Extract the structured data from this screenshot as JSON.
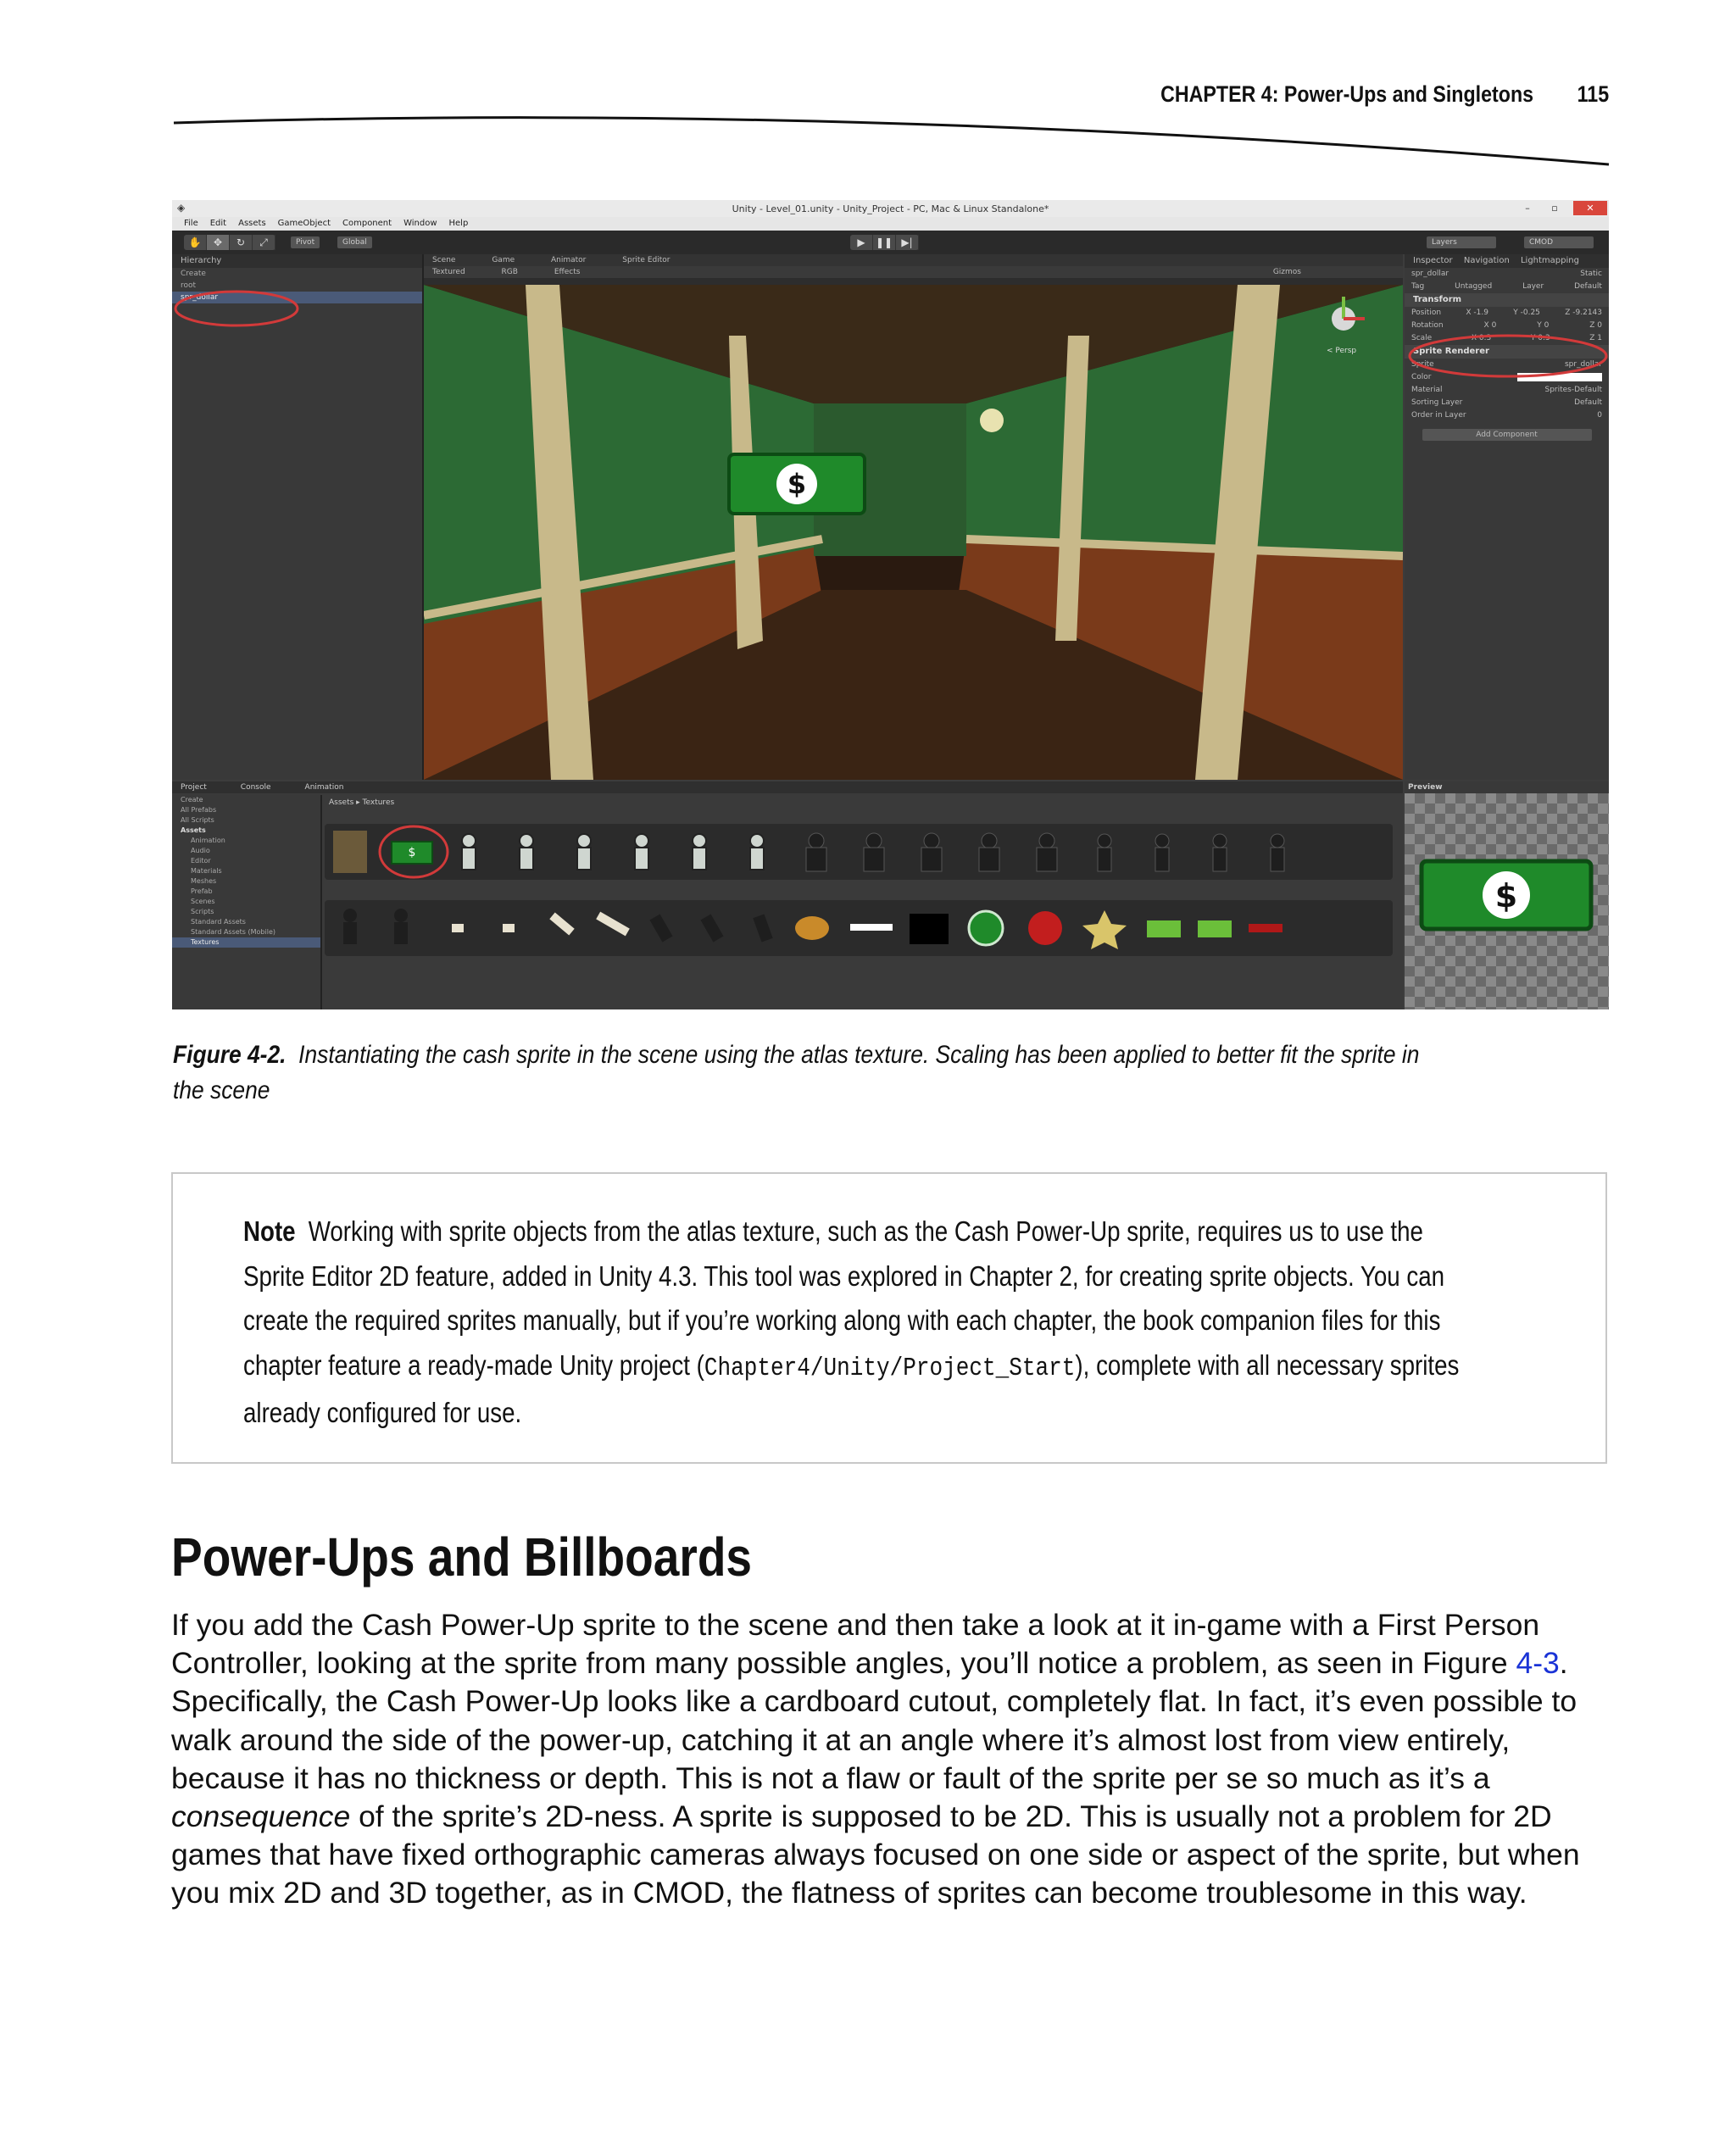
{
  "header": {
    "chapter": "CHAPTER 4: Power-Ups and Singletons",
    "page_number": "115"
  },
  "figure": {
    "unity": {
      "window_title": "Unity - Level_01.unity - Unity_Project - PC, Mac & Linux Standalone*",
      "window_buttons": [
        "–",
        "▫",
        "✕"
      ],
      "menu": [
        "File",
        "Edit",
        "Assets",
        "GameObject",
        "Component",
        "Window",
        "Help"
      ],
      "toolbar": {
        "pivot": "Pivot",
        "global": "Global",
        "layers": "Layers",
        "layout": "CMOD"
      },
      "hierarchy": {
        "tab": "Hierarchy",
        "create": "Create",
        "items": [
          "root",
          "spr_dollar"
        ]
      },
      "scene": {
        "tabs": [
          "Scene",
          "Game",
          "Animator",
          "Sprite Editor"
        ],
        "shading": "Textured",
        "mode": "RGB",
        "effects": "Effects",
        "gizmos": "Gizmos",
        "persp": "< Persp"
      },
      "inspector": {
        "tabs": [
          "Inspector",
          "Navigation",
          "Lightmapping"
        ],
        "object_name": "spr_dollar",
        "static": "Static",
        "tag": "Untagged",
        "layer": "Default",
        "transform": "Transform",
        "position": [
          "X -1.9",
          "Y -0.25",
          "Z -9.2143"
        ],
        "rotation": [
          "X 0",
          "Y 0",
          "Z 0"
        ],
        "scale": [
          "X 0.3",
          "Y 0.3",
          "Z 1"
        ],
        "sprite_renderer": "Sprite Renderer",
        "sprite": "spr_dollar",
        "material": "Sprites-Default",
        "sorting_layer": "Default",
        "order_in_layer": "0",
        "add_component": "Add Component",
        "labels": [
          "Position",
          "Rotation",
          "Scale",
          "Sprite",
          "Color",
          "Material",
          "Sorting Layer",
          "Order in Layer",
          "Tag",
          "Layer"
        ]
      },
      "project": {
        "tabs": [
          "Project",
          "Console",
          "Animation"
        ],
        "create": "Create",
        "favorites": [
          "All Prefabs",
          "All Scripts"
        ],
        "assets_folder": "Assets",
        "folders": [
          "Animation",
          "Audio",
          "Editor",
          "Materials",
          "Meshes",
          "Prefab",
          "Scenes",
          "Scripts",
          "Standard Assets",
          "Standard Assets (Mobile)",
          "Textures"
        ],
        "breadcrumb": "Assets ▸ Textures"
      },
      "preview_label": "Preview"
    }
  },
  "caption": {
    "label": "Figure 4-2.",
    "text": "Instantiating the cash sprite in the scene using the atlas texture. Scaling has been applied to better fit the sprite in the scene"
  },
  "note": {
    "label": "Note",
    "text_before": "Working with sprite objects from the atlas texture, such as the Cash Power-Up sprite, requires us to use the Sprite Editor 2D feature, added in Unity 4.3. This tool was explored in Chapter 2, for creating sprite objects. You can create the required sprites manually, but if you’re working along with each chapter, the book companion files for this chapter feature a ready-made Unity project (",
    "code": "Chapter4/Unity/Project_Start",
    "text_after": "), complete with all necessary sprites already configured for use."
  },
  "section": {
    "heading": "Power-Ups and Billboards",
    "p1": "If you add the Cash Power-Up sprite to the scene and then take a look at it in-game with a First Person Controller, looking at the sprite from many possible angles, you’ll notice a problem, as seen in Figure ",
    "link": "4-3",
    "p2": ". Specifically, the Cash Power-Up looks like a cardboard cutout, completely flat. In fact, it’s even possible to walk around the side of the power-up, catching it at an angle where it’s almost lost from view entirely, because it has no thickness or depth. This is not a flaw or fault of the sprite per se so much as it’s a ",
    "emphasis": "consequence",
    "p3": " of the sprite’s 2D-ness. A sprite is supposed to be 2D. This is usually not a problem for 2D games that have fixed orthographic cameras always focused on one side or aspect of the sprite, but when you mix 2D and 3D together, as in CMOD, the flatness of sprites can become troublesome in this way."
  },
  "colors": {
    "link": "#1a33d6",
    "annotation_circle": "#d23a3a",
    "cash_green": "#1f8a2a"
  }
}
